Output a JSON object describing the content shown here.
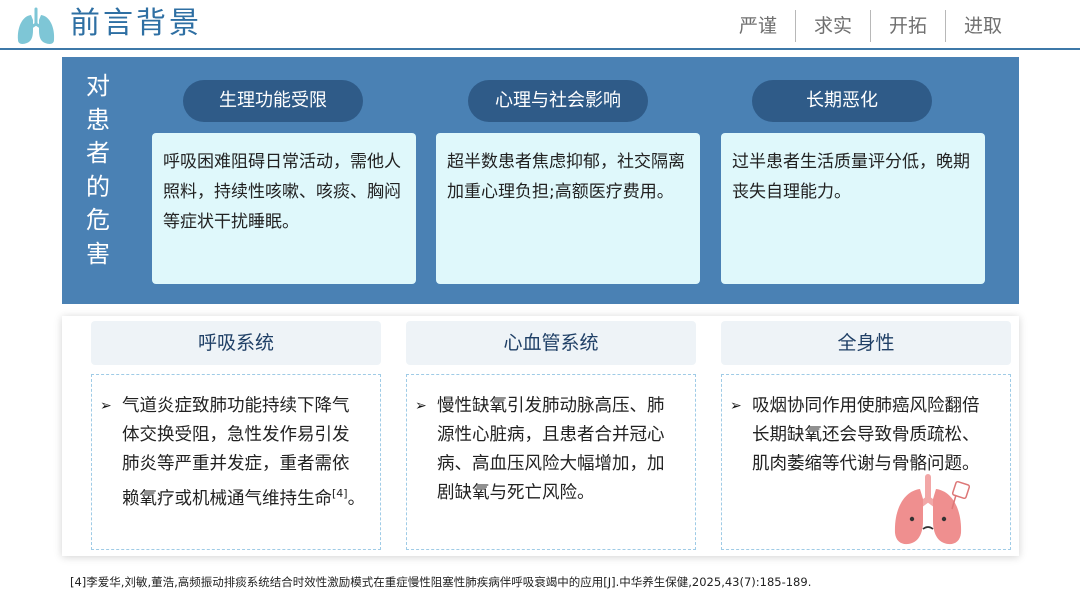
{
  "header": {
    "title": "前言背景",
    "nav": [
      "严谨",
      "求实",
      "开拓",
      "进取"
    ]
  },
  "harm": {
    "vertical_title": [
      "对",
      "患",
      "者",
      "的",
      "危",
      "害"
    ],
    "items": [
      {
        "label": "生理功能受限",
        "text": "呼吸困难阻碍日常活动，需他人照料，持续性咳嗽、咳痰、胸闷等症状干扰睡眠。"
      },
      {
        "label": "心理与社会影响",
        "text": "超半数患者焦虑抑郁，社交隔离加重心理负担;高额医疗费用。"
      },
      {
        "label": "长期恶化",
        "text": "过半患者生活质量评分低，晚期丧失自理能力。"
      }
    ]
  },
  "systems": [
    {
      "label": "呼吸系统",
      "bullet": "➢",
      "text": "气道炎症致肺功能持续下降气体交换受阻，急性发作易引发肺炎等严重并发症，重者需依赖氧疗或机械通气维持生命",
      "ref": "[4]",
      "tail": "。"
    },
    {
      "label": "心血管系统",
      "bullet": "➢",
      "text": "慢性缺氧引发肺动脉高压、肺源性心脏病，且患者合并冠心病、高血压风险大幅增加，加剧缺氧与死亡风险。",
      "ref": "",
      "tail": ""
    },
    {
      "label": "全身性",
      "bullet": "➢",
      "text": "吸烟协同作用使肺癌风险翻倍长期缺氧还会导致骨质疏松、肌肉萎缩等代谢与骨骼问题。",
      "ref": "",
      "tail": ""
    }
  ],
  "footer": {
    "citation": "[4]李爱华,刘敏,董浩,高频振动排痰系统结合时效性激励模式在重症慢性阻塞性肺疾病伴呼吸衰竭中的应用[J].中华养生保健,2025,43(7):185-189."
  },
  "colors": {
    "primary": "#2e6fa3",
    "panel": "#4a81b4",
    "pill": "#2f5b88",
    "card": "#dff8fb"
  }
}
